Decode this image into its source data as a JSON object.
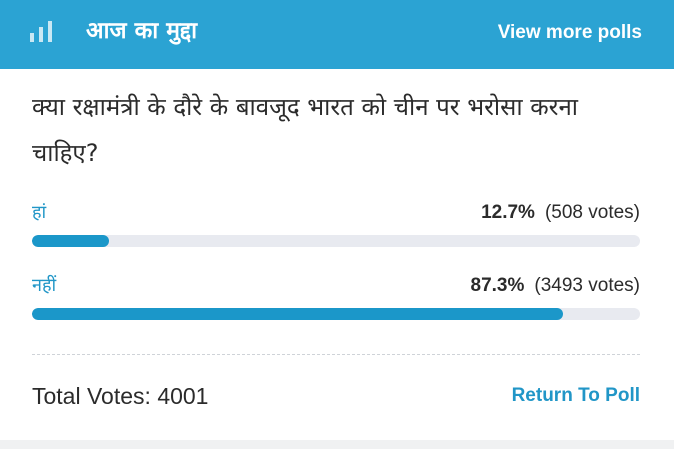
{
  "header": {
    "icon": "bar-chart-icon",
    "title": "आज का मुद्दा",
    "view_more_label": "View more polls",
    "background_color": "#2ba3d3"
  },
  "poll": {
    "question": "क्या रक्षामंत्री के दौरे के बावजूद भारत को चीन पर भरोसा करना चाहिए?",
    "accent_color": "#1b97c9",
    "options": [
      {
        "label": "हां",
        "percent_text": "12.7%",
        "votes_text": "(508 votes)",
        "fraction": 0.127
      },
      {
        "label": "नहीं",
        "percent_text": "87.3%",
        "votes_text": "(3493 votes)",
        "fraction": 0.873
      }
    ]
  },
  "footer": {
    "total_label": "Total Votes:",
    "total_value": "4001",
    "return_label": "Return To Poll"
  }
}
